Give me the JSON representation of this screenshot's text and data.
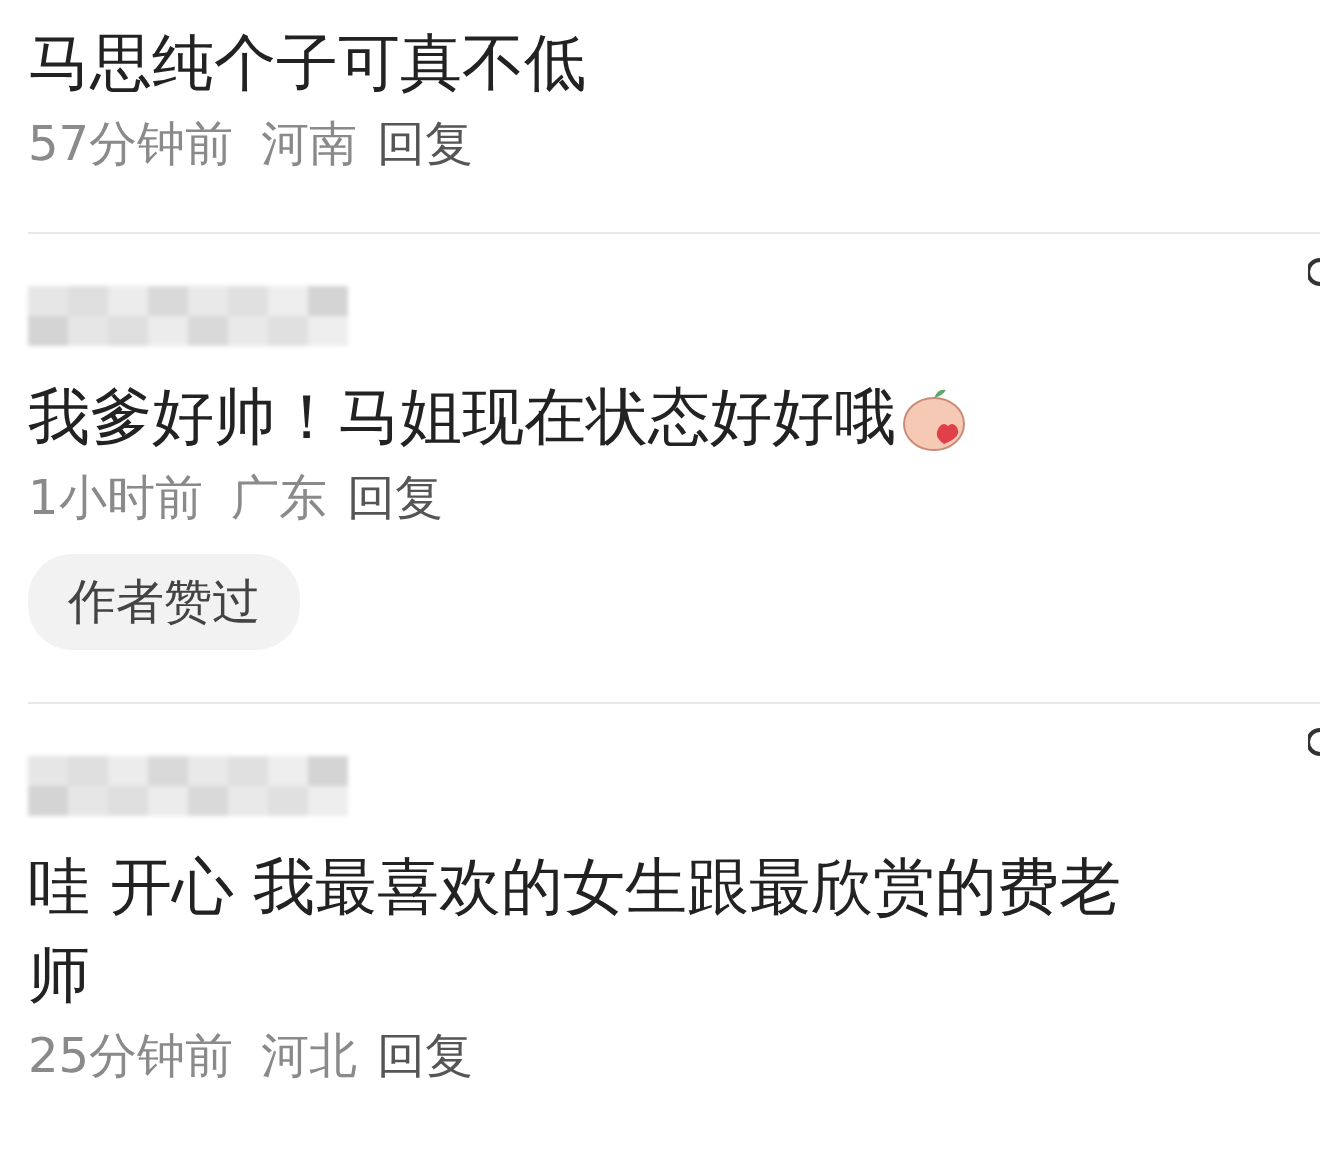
{
  "comments": [
    {
      "author_blurred": false,
      "text": "马思纯个子可真不低",
      "emoji": false,
      "time": "57分钟前",
      "location": "河南",
      "reply": "回复",
      "side_icon": false
    },
    {
      "author_blurred": true,
      "text": "我爹好帅！马姐现在状态好好哦",
      "emoji": true,
      "time": "1小时前",
      "location": "广东",
      "reply": "回复",
      "badge": "作者赞过",
      "side_icon": true
    },
    {
      "author_blurred": true,
      "text": "哇 开心 我最喜欢的女生跟最欣赏的费老师",
      "emoji": false,
      "time": "25分钟前",
      "location": "河北",
      "reply": "回复",
      "side_icon": true
    }
  ]
}
